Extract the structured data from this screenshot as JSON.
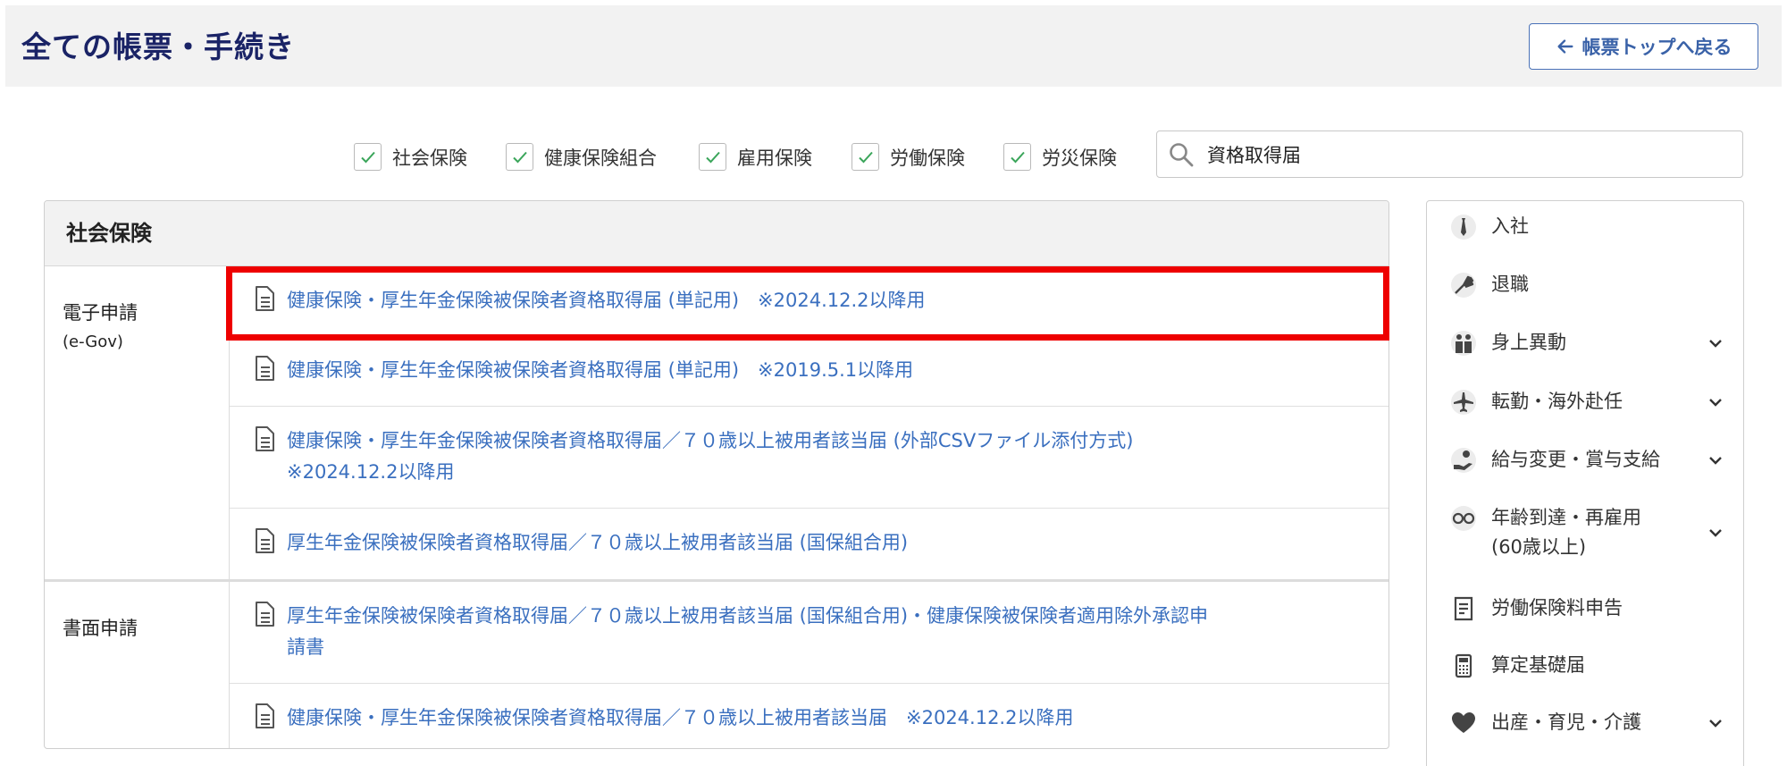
{
  "header": {
    "title": "全ての帳票・手続き",
    "back_label": "帳票トップへ戻る"
  },
  "filters": [
    {
      "label": "社会保険",
      "checked": true
    },
    {
      "label": "健康保険組合",
      "checked": true
    },
    {
      "label": "雇用保険",
      "checked": true
    },
    {
      "label": "労働保険",
      "checked": true
    },
    {
      "label": "労災保険",
      "checked": true
    }
  ],
  "search": {
    "value": "資格取得届",
    "placeholder": ""
  },
  "main": {
    "section_title": "社会保険",
    "groups": [
      {
        "label": "電子申請",
        "sublabel": "(e-Gov)",
        "items": [
          {
            "text": "健康保険・厚生年金保険被保険者資格取得届 (単記用)　※2024.12.2以降用"
          },
          {
            "text": "健康保険・厚生年金保険被保険者資格取得届 (単記用)　※2019.5.1以降用"
          },
          {
            "text": "健康保険・厚生年金保険被保険者資格取得届／７０歳以上被用者該当届 (外部CSVファイル添付方式)",
            "text2": "※2024.12.2以降用"
          },
          {
            "text": "厚生年金保険被保険者資格取得届／７０歳以上被用者該当届 (国保組合用)"
          }
        ]
      },
      {
        "label": "書面申請",
        "sublabel": "",
        "items": [
          {
            "text": "厚生年金保険被保険者資格取得届／７０歳以上被用者該当届 (国保組合用)・健康保険被保険者適用除外承認申",
            "text2": "請書"
          },
          {
            "text": "健康保険・厚生年金保険被保険者資格取得届／７０歳以上被用者該当届　※2024.12.2以降用"
          }
        ]
      }
    ]
  },
  "sidebar": {
    "items": [
      {
        "label": "入社",
        "icon": "necktie-icon",
        "expandable": false
      },
      {
        "label": "退職",
        "icon": "bouquet-icon",
        "expandable": false
      },
      {
        "label": "身上異動",
        "icon": "people-icon",
        "expandable": true
      },
      {
        "label": "転勤・海外赴任",
        "icon": "airplane-icon",
        "expandable": true
      },
      {
        "label": "給与変更・賞与支給",
        "icon": "money-hand-icon",
        "expandable": true
      },
      {
        "label": "年齢到達・再雇用",
        "label2": "(60歳以上)",
        "icon": "glasses-icon",
        "expandable": true
      },
      {
        "label": "労働保険料申告",
        "icon": "document-lines-icon",
        "expandable": false
      },
      {
        "label": "算定基礎届",
        "icon": "calculator-icon",
        "expandable": false
      },
      {
        "label": "出産・育児・介護",
        "icon": "heart-icon",
        "expandable": true
      }
    ]
  },
  "colors": {
    "title": "#1a2366",
    "link": "#3a6fbf",
    "highlight": "#ee0000",
    "check": "#3aa55a"
  }
}
